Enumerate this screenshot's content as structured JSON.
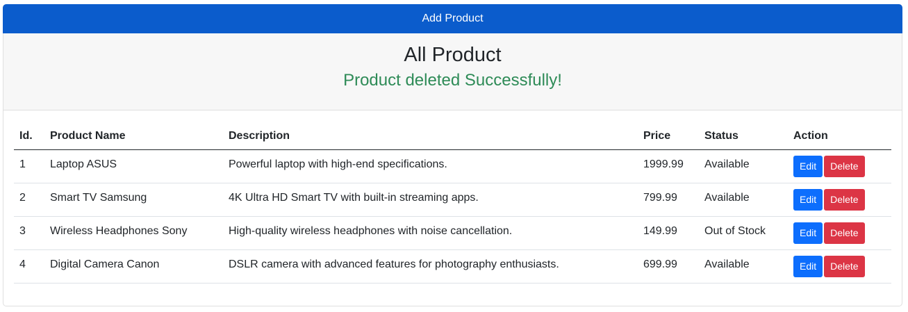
{
  "header": {
    "add_button": "Add Product",
    "title": "All Product",
    "alert": "Product deleted Successfully!"
  },
  "table": {
    "columns": [
      "Id.",
      "Product Name",
      "Description",
      "Price",
      "Status",
      "Action"
    ],
    "rows": [
      {
        "id": "1",
        "name": "Laptop ASUS",
        "description": "Powerful laptop with high-end specifications.",
        "price": "1999.99",
        "status": "Available"
      },
      {
        "id": "2",
        "name": "Smart TV Samsung",
        "description": "4K Ultra HD Smart TV with built-in streaming apps.",
        "price": "799.99",
        "status": "Available"
      },
      {
        "id": "3",
        "name": "Wireless Headphones Sony",
        "description": "High-quality wireless headphones with noise cancellation.",
        "price": "149.99",
        "status": "Out of Stock"
      },
      {
        "id": "4",
        "name": "Digital Camera Canon",
        "description": "DSLR camera with advanced features for photography enthusiasts.",
        "price": "699.99",
        "status": "Available"
      }
    ],
    "edit_label": "Edit",
    "delete_label": "Delete"
  },
  "colors": {
    "primary": "#0b5ccc",
    "edit": "#0d6efd",
    "delete": "#dc3545",
    "success_text": "#2e8b57"
  }
}
